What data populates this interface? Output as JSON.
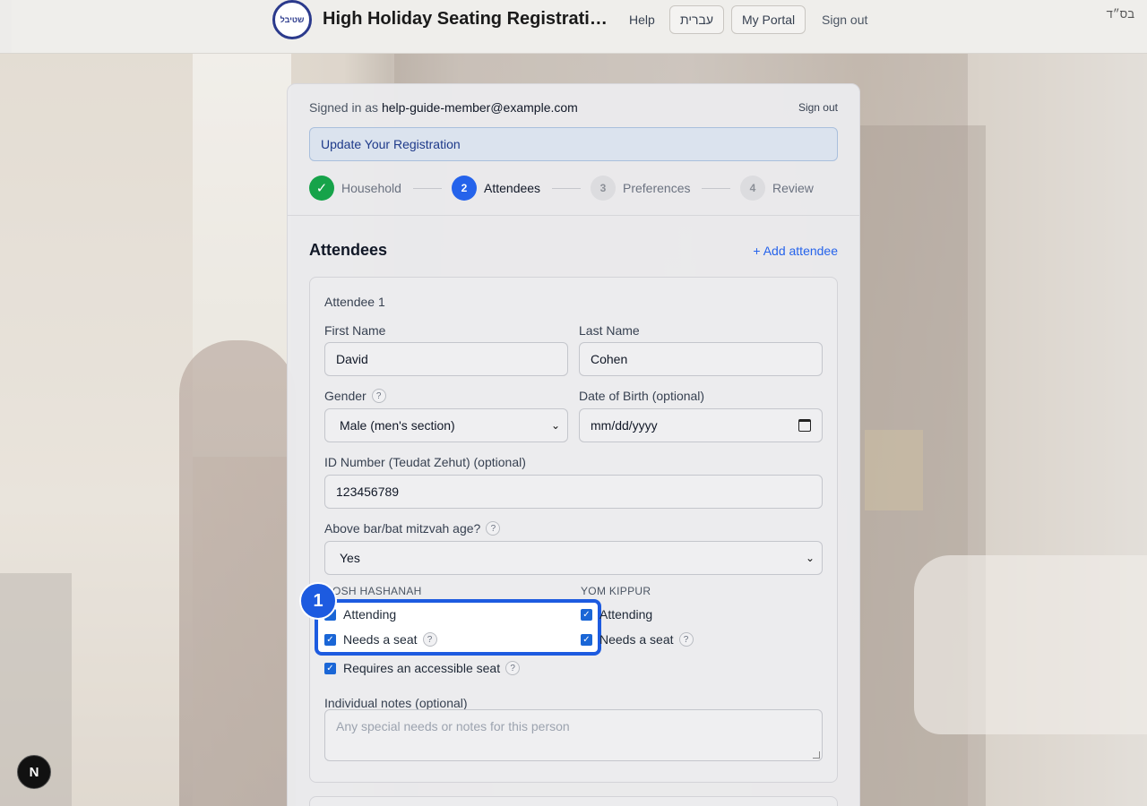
{
  "header": {
    "logo_text": "שטיבל",
    "title": "High Holiday Seating Registration",
    "help": "Help",
    "hebrew": "עברית",
    "portal": "My Portal",
    "signout": "Sign out",
    "bsd": "בס״ד"
  },
  "card": {
    "signed_prefix": "Signed in as",
    "email": "help-guide-member@example.com",
    "signout": "Sign out",
    "banner": "Update Your Registration",
    "steps": [
      {
        "num": "✓",
        "label": "Household",
        "state": "done"
      },
      {
        "num": "2",
        "label": "Attendees",
        "state": "active"
      },
      {
        "num": "3",
        "label": "Preferences",
        "state": "todo"
      },
      {
        "num": "4",
        "label": "Review",
        "state": "todo"
      }
    ],
    "section_title": "Attendees",
    "add_attendee": "+ Add attendee"
  },
  "attendee": {
    "title": "Attendee 1",
    "first_name_label": "First Name",
    "first_name": "David",
    "last_name_label": "Last Name",
    "last_name": "Cohen",
    "gender_label": "Gender",
    "gender": "Male (men's section)",
    "dob_label": "Date of Birth (optional)",
    "dob_placeholder": "mm/dd/yyyy",
    "id_label": "ID Number (Teudat Zehut) (optional)",
    "id_value": "123456789",
    "mitzvah_label": "Above bar/bat mitzvah age?",
    "mitzvah_value": "Yes",
    "rh_head": "ROSH HASHANAH",
    "yk_head": "YOM KIPPUR",
    "attending": "Attending",
    "needs_seat": "Needs a seat",
    "accessible": "Requires an accessible seat",
    "notes_label": "Individual notes (optional)",
    "notes_placeholder": "Any special needs or notes for this person"
  },
  "guide": {
    "badge": "1",
    "next_badge": "N"
  },
  "colors": {
    "primary": "#2563eb",
    "success": "#16a34a",
    "highlight": "#1d5be0"
  }
}
